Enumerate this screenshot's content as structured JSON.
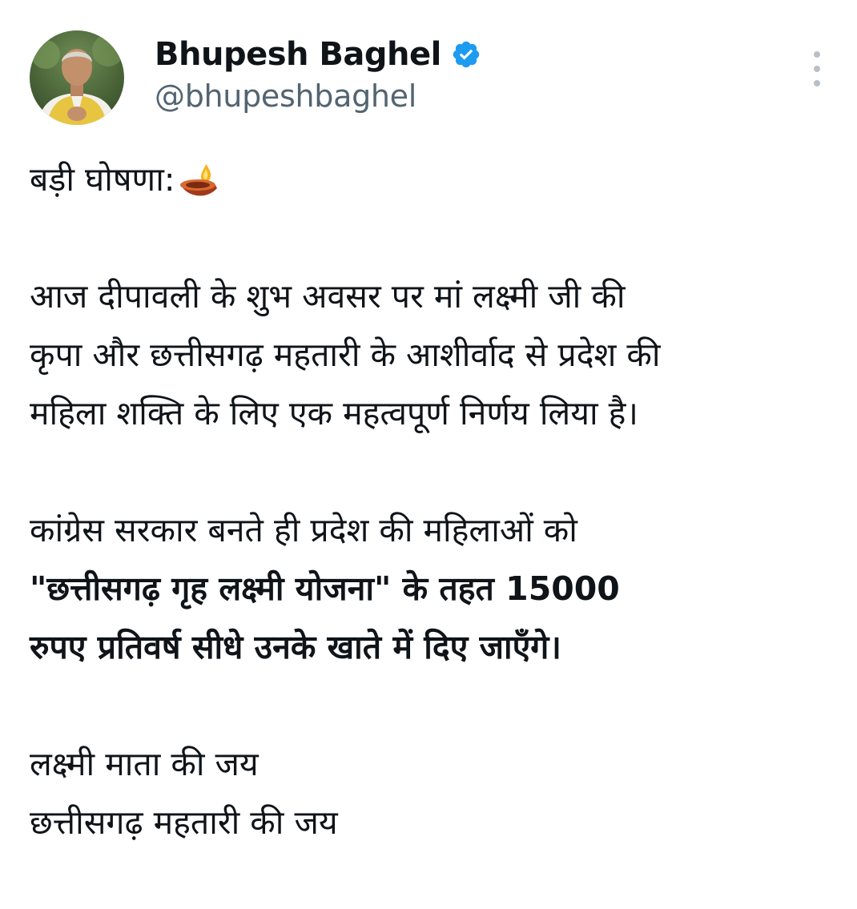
{
  "author": {
    "display_name": "Bhupesh Baghel",
    "handle": "@bhupeshbaghel",
    "verified": true,
    "avatar_icon": "profile-photo"
  },
  "menu": {
    "icon": "more-vertical-icon"
  },
  "tweet": {
    "heading": "बड़ी घोषणा:",
    "heading_emoji": "diya-icon",
    "para1": [
      "आज दीपावली के शुभ अवसर पर मां लक्ष्मी जी की",
      "कृपा और छत्तीसगढ़ महतारी के आशीर्वाद से प्रदेश की",
      "महिला शक्ति के लिए एक महत्वपूर्ण निर्णय लिया है।"
    ],
    "para2_line1": "कांग्रेस सरकार बनते ही प्रदेश की महिलाओं को",
    "para2_line2": "\"छत्तीसगढ़ गृह लक्ष्मी योजना\" के तहत 15000",
    "para2_line3": "रुपए प्रतिवर्ष सीधे उनके खाते में दिए जाएँगे।",
    "closing": [
      "लक्ष्मी माता की जय",
      "छत्तीसगढ़ महतारी की जय"
    ]
  },
  "colors": {
    "text": "#0f1419",
    "secondary": "#536471",
    "verified_blue": "#1d9bf0"
  }
}
